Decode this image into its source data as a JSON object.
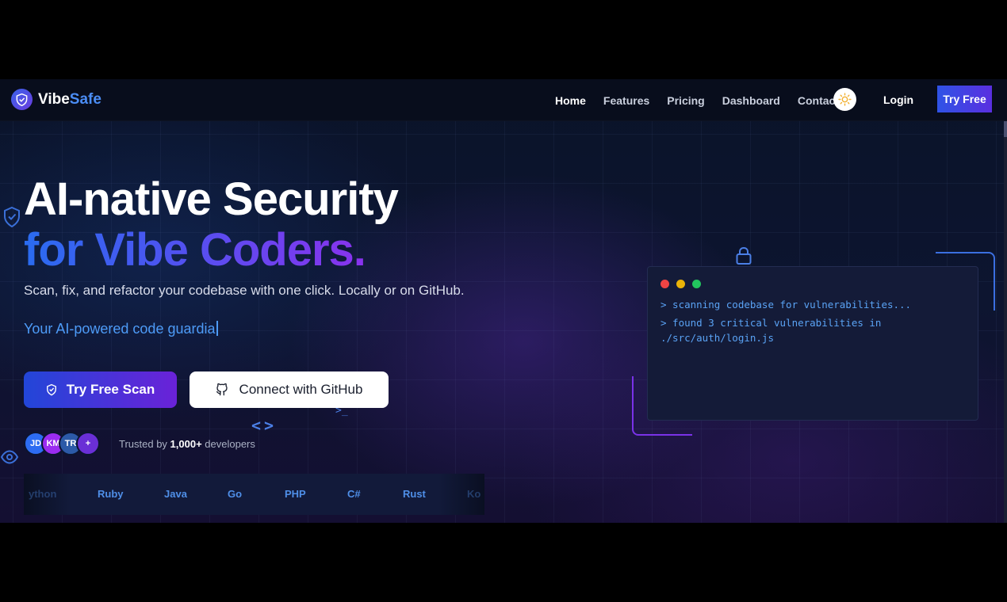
{
  "brand": {
    "name_main": "Vibe",
    "name_accent": "Safe",
    "logo_icon": "shield-check-icon"
  },
  "nav": {
    "links": [
      "Home",
      "Features",
      "Pricing",
      "Dashboard",
      "Contact"
    ],
    "active": "Home",
    "theme_icon": "sun-icon",
    "login": "Login",
    "cta": "Try Free"
  },
  "hero": {
    "headline_line1": "AI-native Security",
    "headline_line2": "for Vibe Coders.",
    "subtitle": "Scan, fix, and refactor your codebase with one click. Locally or on GitHub.",
    "typing_text": "Your AI-powered code guardia",
    "primary_button": "Try Free Scan",
    "secondary_button": "Connect with GitHub"
  },
  "social_proof": {
    "avatars": [
      {
        "initials": "JD",
        "color": "#2d6cf2"
      },
      {
        "initials": "KM",
        "color": "#9b2cf0"
      },
      {
        "initials": "TR",
        "color": "#2c5aa8"
      },
      {
        "initials": "+",
        "color": "#6a2fd6"
      }
    ],
    "prefix": "Trusted by ",
    "count": "1,000+",
    "suffix": " developers"
  },
  "languages": [
    "ython",
    "Ruby",
    "Java",
    "Go",
    "PHP",
    "C#",
    "Rust",
    "Ko"
  ],
  "terminal": {
    "lines": [
      "> scanning codebase for vulnerabilities...",
      "> found 3 critical vulnerabilities in",
      "./src/auth/login.js"
    ]
  },
  "decor": {
    "code_brackets": "<>",
    "prompt_symbol": ">_"
  },
  "colors": {
    "accent_blue": "#2f53e6",
    "accent_purple": "#6a22d8",
    "terminal_text": "#5aa3f5"
  }
}
